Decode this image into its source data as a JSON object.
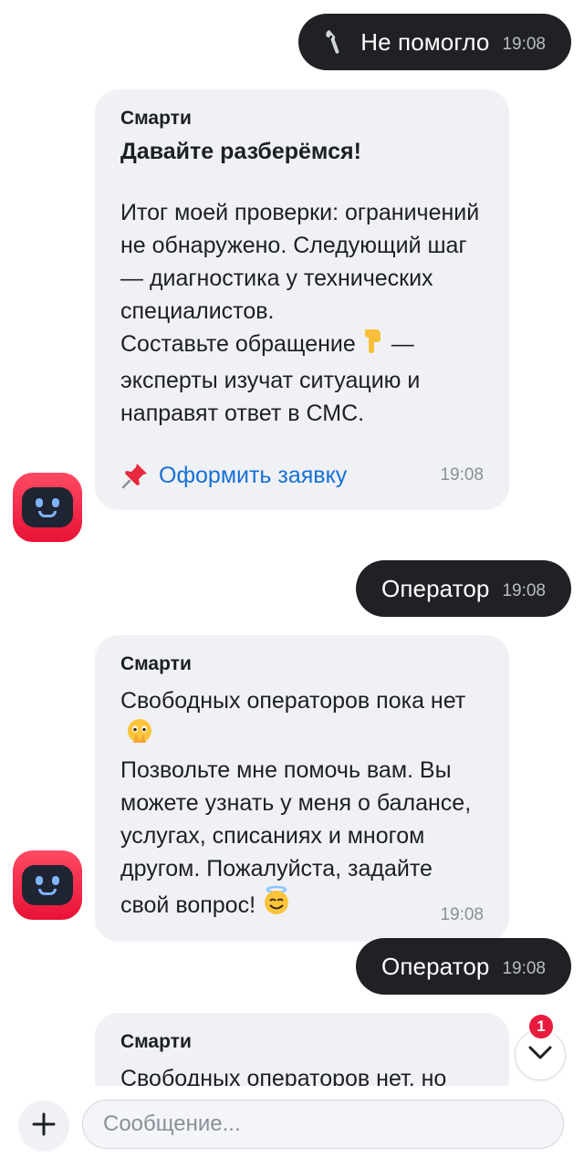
{
  "messages": {
    "out1": {
      "text": "Не помогло",
      "time": "19:08",
      "icon": "wrench-icon"
    },
    "in1": {
      "sender": "Смарти",
      "title": "Давайте разберёмся!",
      "text": "Итог моей проверки: ограничений не обнаружено. Следующий шаг — диагностика у технических специалистов.",
      "text2_before_emoji": "Составьте обращение",
      "emoji": "pointing-down-emoji",
      "text2_after_emoji": "— эксперты изучат ситуацию и направят ответ в СМС.",
      "action": {
        "label": "Оформить заявку",
        "icon": "pushpin-icon"
      },
      "time": "19:08"
    },
    "out2": {
      "text": "Оператор",
      "time": "19:08"
    },
    "in2": {
      "sender": "Смарти",
      "line1": "Свободных операторов пока нет",
      "emoji1": "pleading-hands-emoji",
      "text": "Позвольте мне помочь вам. Вы можете узнать у меня о балансе, услугах, списаниях и многом другом. Пожалуйста, задайте свой вопрос!",
      "emoji2": "smiling-angel-emoji",
      "time": "19:08"
    },
    "out3": {
      "text": "Оператор",
      "time": "19:08"
    },
    "in3": {
      "sender": "Смарти",
      "text": "Свободных операторов нет, но"
    }
  },
  "scroll": {
    "unread_count": "1"
  },
  "composer": {
    "placeholder": "Сообщение..."
  },
  "colors": {
    "outgoing_bubble": "#1f2125",
    "incoming_bubble": "#f0f1f5",
    "link": "#1670d6",
    "brand_red": "#e81236"
  }
}
